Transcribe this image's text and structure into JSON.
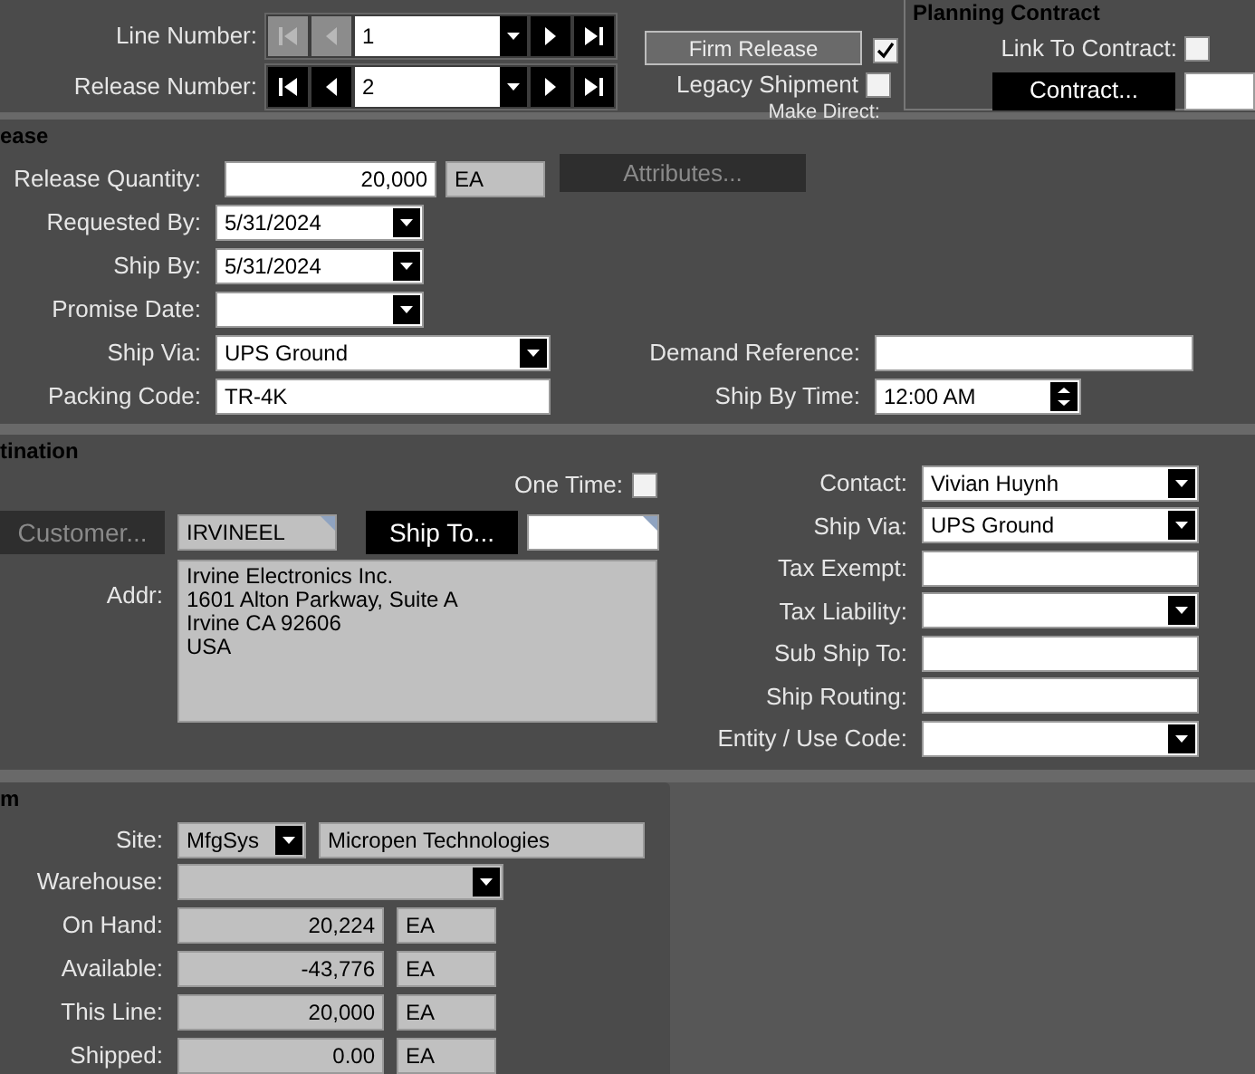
{
  "navigators": [
    {
      "label": "Line Number:",
      "value": "1",
      "back_disabled": true
    },
    {
      "label": "Release Number:",
      "value": "2",
      "back_disabled": false
    }
  ],
  "firm_release": {
    "label": "Firm Release",
    "checked": true
  },
  "legacy_shipment": {
    "label": "Legacy Shipment",
    "checked": false
  },
  "make_direct": {
    "label": "Make Direct:"
  },
  "planning_contract": {
    "title": "Planning Contract",
    "link_label": "Link To Contract:",
    "link_checked": false,
    "contract_button": "Contract..."
  },
  "release": {
    "title": "ease",
    "quantity": {
      "label": "Release Quantity:",
      "value": "20,000",
      "uom": "EA"
    },
    "attributes_button": {
      "label": "Attributes...",
      "disabled": true
    },
    "left_fields": [
      {
        "label": "Requested By:",
        "kind": "date",
        "value": "5/31/2024"
      },
      {
        "label": "Ship By:",
        "kind": "date",
        "value": "5/31/2024"
      },
      {
        "label": "Promise Date:",
        "kind": "date"
      },
      {
        "label": "Ship Via:",
        "kind": "dropdown",
        "value": "UPS Ground"
      },
      {
        "label": "Packing Code:",
        "kind": "text",
        "value": "TR-4K"
      }
    ],
    "right_fields": [
      {
        "label": "Demand Reference:",
        "kind": "text"
      },
      {
        "label": "Ship By Time:",
        "kind": "spinner",
        "value": "12:00 AM"
      }
    ]
  },
  "destination": {
    "title": "tination",
    "one_time": {
      "label": "One Time:",
      "checked": false
    },
    "customer_button": {
      "label": "Customer...",
      "disabled": true
    },
    "customer_id": "IRVINEEL",
    "ship_to_button": {
      "label": "Ship To...",
      "disabled": false
    },
    "addr_label": "Addr:",
    "address_lines": [
      "Irvine Electronics Inc.",
      "1601 Alton Parkway, Suite A",
      "Irvine CA 92606",
      "USA"
    ],
    "right_fields": [
      {
        "label": "Contact:",
        "kind": "dropdown",
        "value": "Vivian Huynh"
      },
      {
        "label": "Ship Via:",
        "kind": "dropdown",
        "value": "UPS Ground"
      },
      {
        "label": "Tax Exempt:",
        "kind": "text"
      },
      {
        "label": "Tax Liability:",
        "kind": "dropdown"
      },
      {
        "label": "Sub Ship To:",
        "kind": "text"
      },
      {
        "label": "Ship Routing:",
        "kind": "text"
      },
      {
        "label": "Entity / Use Code:",
        "kind": "dropdown"
      }
    ]
  },
  "item": {
    "title": "m",
    "site": {
      "label": "Site:",
      "value": "MfgSys",
      "name": "Micropen Technologies"
    },
    "warehouse": {
      "label": "Warehouse:"
    },
    "quantities": [
      {
        "label": "On Hand:",
        "value": "20,224",
        "uom": "EA"
      },
      {
        "label": "Available:",
        "value": "-43,776",
        "uom": "EA"
      },
      {
        "label": "This Line:",
        "value": "20,000",
        "uom": "EA"
      },
      {
        "label": "Shipped:",
        "value": "0.00",
        "uom": "EA"
      }
    ]
  }
}
